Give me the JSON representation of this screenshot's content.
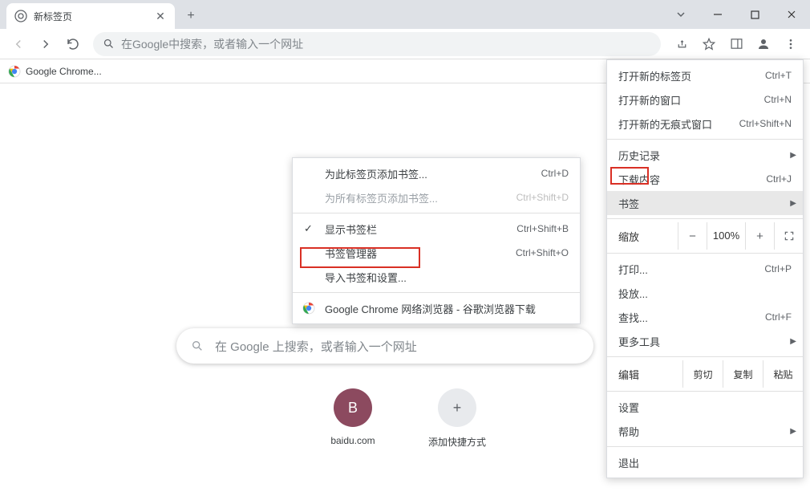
{
  "tab": {
    "title": "新标签页"
  },
  "omnibox": {
    "placeholder": "在Google中搜索，或者输入一个网址"
  },
  "bookmarks_bar": {
    "item1": "Google Chrome..."
  },
  "searchbox": {
    "placeholder": "在 Google 上搜索，或者输入一个网址"
  },
  "shortcuts": [
    {
      "letter": "B",
      "label": "baidu.com"
    },
    {
      "label": "添加快捷方式"
    }
  ],
  "menu": {
    "new_tab": "打开新的标签页",
    "new_tab_sc": "Ctrl+T",
    "new_window": "打开新的窗口",
    "new_window_sc": "Ctrl+N",
    "new_incognito": "打开新的无痕式窗口",
    "new_incognito_sc": "Ctrl+Shift+N",
    "history": "历史记录",
    "downloads": "下载内容",
    "downloads_sc": "Ctrl+J",
    "bookmarks": "书签",
    "zoom_label": "缩放",
    "zoom_value": "100%",
    "print": "打印...",
    "print_sc": "Ctrl+P",
    "cast": "投放...",
    "find": "查找...",
    "find_sc": "Ctrl+F",
    "more_tools": "更多工具",
    "edit_label": "编辑",
    "cut": "剪切",
    "copy": "复制",
    "paste": "粘贴",
    "settings": "设置",
    "help": "帮助",
    "exit": "退出"
  },
  "submenu": {
    "add_bookmark": "为此标签页添加书签...",
    "add_bookmark_sc": "Ctrl+D",
    "add_all": "为所有标签页添加书签...",
    "add_all_sc": "Ctrl+Shift+D",
    "show_bar": "显示书签栏",
    "show_bar_sc": "Ctrl+Shift+B",
    "manager": "书签管理器",
    "manager_sc": "Ctrl+Shift+O",
    "import": "导入书签和设置...",
    "chrome_item": "Google Chrome 网络浏览器 - 谷歌浏览器下载"
  }
}
